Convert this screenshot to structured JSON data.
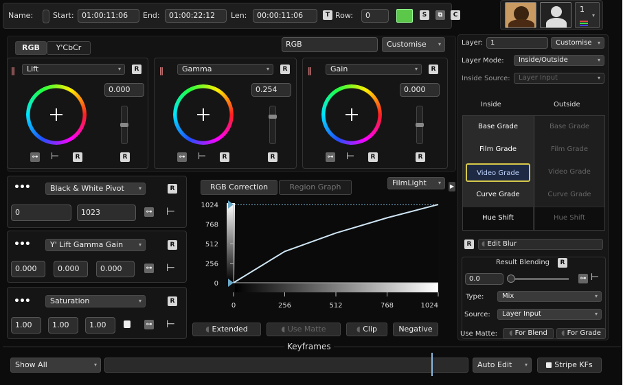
{
  "topbar": {
    "name_label": "Name:",
    "start_label": "Start:",
    "start_value": "01:00:11:06",
    "end_label": "End:",
    "end_value": "01:00:22:12",
    "len_label": "Len:",
    "len_value": "00:00:11:06",
    "row_label": "Row:",
    "row_value": "0",
    "layer_num": "1",
    "accent_color": "#5cc84a"
  },
  "wheels": {
    "tab_rgb": "RGB",
    "tab_ycbcr": "Y'CbCr",
    "space_field": "RGB",
    "customise": "Customise",
    "lift_name": "Lift",
    "lift_value": "0.000",
    "gamma_name": "Gamma",
    "gamma_value": "0.254",
    "gain_name": "Gain",
    "gain_value": "0.000"
  },
  "pivot": {
    "title": "Black & White Pivot",
    "black": "0",
    "white": "1023"
  },
  "lgg": {
    "title": "Y' Lift Gamma Gain",
    "v1": "0.000",
    "v2": "0.000",
    "v3": "0.000"
  },
  "sat": {
    "title": "Saturation",
    "v1": "1.00",
    "v2": "1.00",
    "v3": "1.00"
  },
  "graph": {
    "tab_rgb": "RGB Correction",
    "tab_region": "Region Graph",
    "filmlight": "FilmLight",
    "y_ticks": [
      "1024",
      "768",
      "512",
      "256",
      "0"
    ],
    "x_ticks": [
      "0",
      "256",
      "512",
      "768",
      "1024"
    ],
    "extended": "Extended",
    "use_matte": "Use Matte",
    "clip": "Clip",
    "negative": "Negative"
  },
  "layer": {
    "layer_label": "Layer:",
    "layer_value": "1",
    "customise": "Customise",
    "mode_label": "Layer Mode:",
    "mode_value": "Inside/Outside",
    "source_label": "Inside Source:",
    "source_value": "Layer Input",
    "inside": "Inside",
    "outside": "Outside",
    "grades": [
      "Base Grade",
      "Film Grade",
      "Video Grade",
      "Curve Grade",
      "Hue Shift"
    ],
    "edit_blur": "Edit Blur",
    "result_blending": "Result Blending",
    "blend_value": "0.0",
    "type_label": "Type:",
    "type_value": "Mix",
    "src_label": "Source:",
    "src_value": "Layer Input",
    "use_matte": "Use Matte:",
    "for_blend": "For Blend",
    "for_grade": "For Grade"
  },
  "keyframes": {
    "title": "Keyframes",
    "show": "Show All",
    "auto_edit": "Auto Edit",
    "stripe": "Stripe KFs"
  },
  "chart_data": {
    "type": "line",
    "x": [
      0,
      256,
      512,
      768,
      1024
    ],
    "y": [
      0,
      410,
      650,
      850,
      1024
    ],
    "xlim": [
      0,
      1024
    ],
    "ylim": [
      0,
      1024
    ]
  }
}
